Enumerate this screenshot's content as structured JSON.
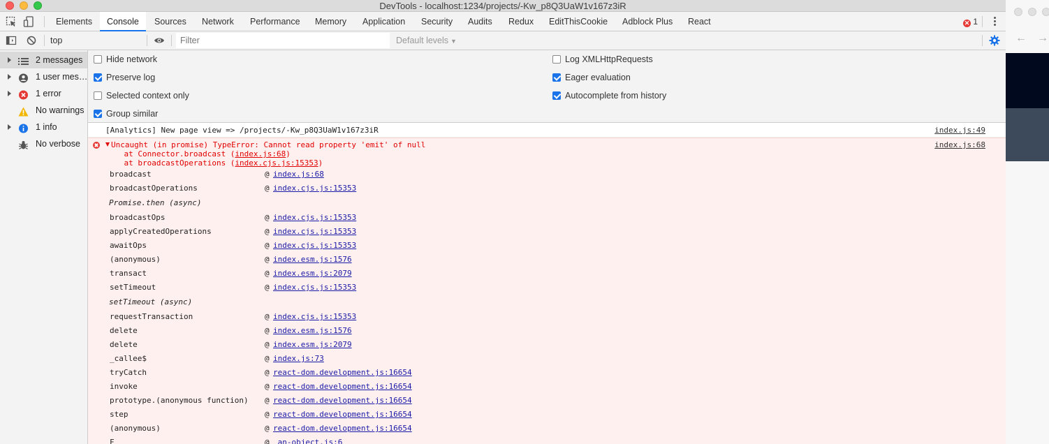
{
  "window": {
    "title": "DevTools - localhost:1234/projects/-Kw_p8Q3UaW1v167z3iR"
  },
  "tabs": [
    {
      "label": "Elements"
    },
    {
      "label": "Console"
    },
    {
      "label": "Sources"
    },
    {
      "label": "Network"
    },
    {
      "label": "Performance"
    },
    {
      "label": "Memory"
    },
    {
      "label": "Application"
    },
    {
      "label": "Security"
    },
    {
      "label": "Audits"
    },
    {
      "label": "Redux"
    },
    {
      "label": "EditThisCookie"
    },
    {
      "label": "Adblock Plus"
    },
    {
      "label": "React"
    }
  ],
  "active_tab": "Console",
  "error_badge": "1",
  "toolbar": {
    "context": "top",
    "filter_placeholder": "Filter",
    "levels": "Default levels"
  },
  "sidebar": {
    "items": [
      {
        "label": "2 messages",
        "icon": "list-icon"
      },
      {
        "label": "1 user mes…",
        "icon": "user-icon"
      },
      {
        "label": "1 error",
        "icon": "error-icon"
      },
      {
        "label": "No warnings",
        "icon": "warning-icon"
      },
      {
        "label": "1 info",
        "icon": "info-icon"
      },
      {
        "label": "No verbose",
        "icon": "bug-icon"
      }
    ]
  },
  "settings": {
    "left": [
      {
        "label": "Hide network",
        "checked": false
      },
      {
        "label": "Preserve log",
        "checked": true
      },
      {
        "label": "Selected context only",
        "checked": false
      },
      {
        "label": "Group similar",
        "checked": true
      }
    ],
    "right": [
      {
        "label": "Log XMLHttpRequests",
        "checked": false
      },
      {
        "label": "Eager evaluation",
        "checked": true
      },
      {
        "label": "Autocomplete from history",
        "checked": true
      }
    ]
  },
  "console": {
    "log": {
      "text": "[Analytics] New page view => /projects/-Kw_p8Q3UaW1v167z3iR",
      "source": "index.js:49"
    },
    "error": {
      "source": "index.js:68",
      "line1": "Uncaught (in promise) TypeError: Cannot read property 'emit' of null",
      "line2_prefix": "    at Connector.broadcast (",
      "line2_link": "index.js:68",
      "line2_suffix": ")",
      "line3_prefix": "    at broadcastOperations (",
      "line3_link": "index.cjs.js:15353",
      "line3_suffix": ")",
      "at_symbol": "@",
      "stack": [
        {
          "fn": "broadcast",
          "loc": "index.js:68"
        },
        {
          "fn": "broadcastOperations",
          "loc": "index.cjs.js:15353"
        },
        {
          "async": "Promise.then (async)"
        },
        {
          "fn": "broadcastOps",
          "loc": "index.cjs.js:15353"
        },
        {
          "fn": "applyCreatedOperations",
          "loc": "index.cjs.js:15353"
        },
        {
          "fn": "awaitOps",
          "loc": "index.cjs.js:15353"
        },
        {
          "fn": "(anonymous)",
          "loc": "index.esm.js:1576"
        },
        {
          "fn": "transact",
          "loc": "index.esm.js:2079"
        },
        {
          "fn": "setTimeout",
          "loc": "index.cjs.js:15353"
        },
        {
          "async": "setTimeout (async)"
        },
        {
          "fn": "requestTransaction",
          "loc": "index.cjs.js:15353"
        },
        {
          "fn": "delete",
          "loc": "index.esm.js:1576"
        },
        {
          "fn": "delete",
          "loc": "index.esm.js:2079"
        },
        {
          "fn": "_callee$",
          "loc": "index.js:73"
        },
        {
          "fn": "tryCatch",
          "loc": "react-dom.development.js:16654"
        },
        {
          "fn": "invoke",
          "loc": "react-dom.development.js:16654"
        },
        {
          "fn": "prototype.(anonymous function)",
          "loc": "react-dom.development.js:16654"
        },
        {
          "fn": "step",
          "loc": "react-dom.development.js:16654"
        },
        {
          "fn": "(anonymous)",
          "loc": "react-dom.development.js:16654"
        },
        {
          "fn": "F",
          "loc": "_an-object.js:6"
        }
      ]
    }
  },
  "colors": {
    "accent": "#1a73e8",
    "error": "#e53935",
    "error_bg": "#fff0f0",
    "link": "#1a1aa6"
  },
  "browser": {
    "back": "←",
    "forward": "→"
  }
}
